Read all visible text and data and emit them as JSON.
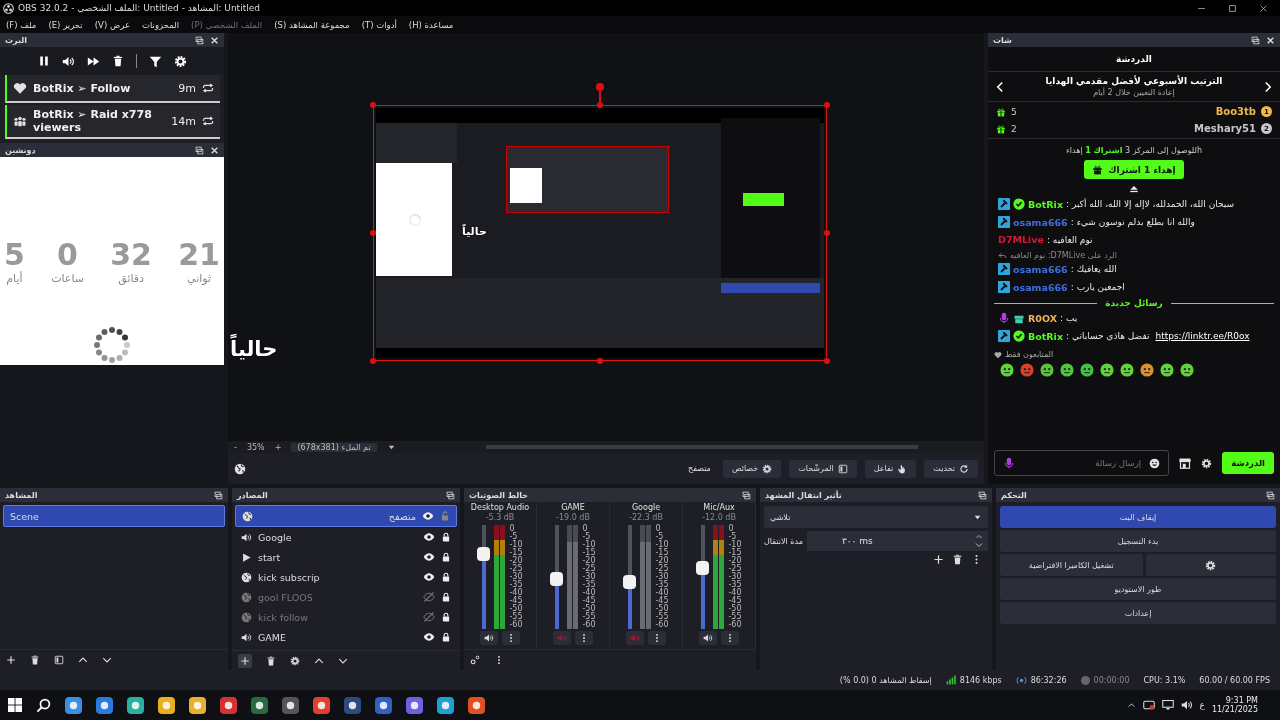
{
  "window": {
    "title": "OBS 32.0.2 - الملف الشخصي: Untitled - المشاهد: Untitled"
  },
  "menu": [
    {
      "label": "مساعدة (H)",
      "disabled": false
    },
    {
      "label": "أدوات (T)",
      "disabled": false
    },
    {
      "label": "مجموعة المشاهد (S)",
      "disabled": false
    },
    {
      "label": "الملف الشخصي (P)",
      "disabled": true
    },
    {
      "label": "المحزونات",
      "disabled": false
    },
    {
      "label": "عرض (V)",
      "disabled": false
    },
    {
      "label": "تحرير (E)",
      "disabled": false
    },
    {
      "label": "ملف (F)",
      "disabled": false
    }
  ],
  "events_dock": {
    "title": "البرت",
    "events": [
      {
        "kind": "follow",
        "text": "BotRix ➢ Follow",
        "time": "9m"
      },
      {
        "kind": "raid",
        "text": "BotRix ➢ Raid x778 viewers",
        "time": "14m"
      }
    ]
  },
  "countdown_dock": {
    "title": "دونشين",
    "counters": [
      {
        "value": "21",
        "unit": "ثواني"
      },
      {
        "value": "32",
        "unit": "دقائق"
      },
      {
        "value": "0",
        "unit": "ساعات"
      },
      {
        "value": "5",
        "unit": "أيام"
      }
    ]
  },
  "preview": {
    "overlay_texts": [
      "حالياً",
      "حالياً"
    ],
    "zoom_out": "-",
    "zoom": "35%",
    "zoom_in": "+",
    "fit": "تم الملء (678x381)"
  },
  "source_toolbar": {
    "source": "متصفح",
    "buttons": [
      {
        "kind": "refresh",
        "label": "تحديث"
      },
      {
        "kind": "interact",
        "label": "تفاعل"
      },
      {
        "kind": "filters",
        "label": "المرشّحات"
      },
      {
        "kind": "properties",
        "label": "خصائص"
      }
    ]
  },
  "chat_dock": {
    "title": "شات",
    "tab": "الدردشة",
    "leaderboard": {
      "title": "الترتيب الأسبوعي لأفضل مقدمي الهدايا",
      "subtitle": "إعادة التعيين خلال 2 أيام",
      "entries": [
        {
          "rank": "1",
          "name": "Boo3tb",
          "count": "5",
          "color": "#f2b84b"
        },
        {
          "rank": "2",
          "name": "Meshary51",
          "count": "2",
          "color": "#c8c8c8"
        }
      ]
    },
    "gift_hint": "hللوصول إلى المركز 3 **اشتراك 1** إهداء",
    "gift_button": "إهداء 1 اشتراك",
    "messages": [
      {
        "user": "BotRix",
        "color": "#53fc18",
        "moderator": true,
        "verified": true,
        "mic_badge": false,
        "gift_badge": false,
        "text": ": سبحان الله، الحمدلله، لاإله إلا الله، الله أكبر"
      },
      {
        "user": "osama666",
        "color": "#3d6fe0",
        "moderator": true,
        "verified": false,
        "mic_badge": false,
        "gift_badge": false,
        "text": ": والله انا بطلع بدلم نوسون شيء"
      },
      {
        "user": "D7MLive",
        "color": "#d4173a",
        "moderator": false,
        "verified": false,
        "mic_badge": false,
        "gift_badge": false,
        "text": ": نوم العافيه"
      },
      {
        "reply": "الرد على D7MLive: نوم العافيه",
        "user": "osama666",
        "color": "#3d6fe0",
        "moderator": true,
        "verified": false,
        "mic_badge": false,
        "gift_badge": false,
        "text": ": الله يعافيك"
      },
      {
        "user": "osama666",
        "color": "#3d6fe0",
        "moderator": true,
        "verified": false,
        "mic_badge": false,
        "gift_badge": false,
        "text": ": اجمعين يارب"
      }
    ],
    "new_messages": {
      "label": "رسائل جديدة",
      "messages": [
        {
          "user": "R0OX",
          "color": "#f0b45a",
          "moderator": false,
          "verified": false,
          "mic_badge": true,
          "gift_badge": true,
          "text": ": يب"
        },
        {
          "user": "BotRix",
          "color": "#53fc18",
          "moderator": true,
          "verified": true,
          "mic_badge": false,
          "gift_badge": false,
          "text": ": تفضل هاذي حساباتي",
          "link": "https://linktr.ee/R0ox"
        }
      ]
    },
    "followers_only": "المتابعون فقط",
    "input_placeholder": "إرسال رسالة",
    "send": "الدردشة"
  },
  "scenes": {
    "title": "المشاهد",
    "items": [
      {
        "label": "Scene",
        "selected": true
      }
    ]
  },
  "sources": {
    "title": "المصادر",
    "items": [
      {
        "kind": "browser",
        "label": "متصفح",
        "selected": true,
        "visible": true,
        "locked": false
      },
      {
        "kind": "audio",
        "label": "Google",
        "selected": false,
        "visible": true,
        "locked": true
      },
      {
        "kind": "media",
        "label": "start",
        "selected": false,
        "visible": true,
        "locked": true
      },
      {
        "kind": "browser",
        "label": "kick subscrip",
        "selected": false,
        "visible": true,
        "locked": true
      },
      {
        "kind": "browser",
        "label": "gool FLOOS",
        "selected": false,
        "visible": false,
        "locked": true
      },
      {
        "kind": "browser",
        "label": "kick follow",
        "selected": false,
        "visible": false,
        "locked": true
      },
      {
        "kind": "audio",
        "label": "GAME",
        "selected": false,
        "visible": true,
        "locked": true
      }
    ]
  },
  "mixer": {
    "title": "خالط الصوتيات",
    "channels": [
      {
        "name": "Mic/Aux",
        "reading": "-12.0 dB",
        "level": 0.59,
        "muted": false,
        "scale": [
          "0",
          "-5",
          "-10",
          "-15",
          "-20",
          "-25",
          "-30",
          "-35",
          "-40",
          "-45",
          "-50",
          "-55",
          "-60"
        ]
      },
      {
        "name": "Google",
        "reading": "-22.3 dB",
        "level": 0.45,
        "muted": true,
        "scale": [
          "0",
          "-5",
          "-10",
          "-15",
          "-20",
          "-25",
          "-30",
          "-35",
          "-40",
          "-45",
          "-50",
          "-55",
          "-60"
        ]
      },
      {
        "name": "GAME",
        "reading": "-19.0 dB",
        "level": 0.48,
        "muted": true,
        "scale": [
          "0",
          "-5",
          "-10",
          "-15",
          "-20",
          "-25",
          "-30",
          "-35",
          "-40",
          "-45",
          "-50",
          "-55",
          "-60"
        ]
      },
      {
        "name": "Desktop Audio",
        "reading": "-5.3 dB",
        "level": 0.72,
        "muted": false,
        "scale": [
          "0",
          "-5",
          "-10",
          "-15",
          "-20",
          "-25",
          "-30",
          "-35",
          "-40",
          "-45",
          "-50",
          "-55",
          "-60"
        ]
      }
    ]
  },
  "transitions": {
    "title": "تأثير انتقال المشهد",
    "transition": "تلاشي",
    "duration_label": "مدة الانتقال",
    "duration": "٣٠٠ ms"
  },
  "controls": {
    "title": "التحكم",
    "buttons": [
      {
        "label": "إيقاف البث",
        "active": true
      },
      {
        "label": "بدء التسجيل",
        "active": false
      },
      {
        "label": "تشغيل الكاميرا الافتراضية",
        "active": false
      },
      {
        "label": "طور الاستوديو",
        "active": false
      },
      {
        "label": "إعدادات",
        "active": false
      }
    ]
  },
  "status_bar": {
    "dropped": "إسقاط المشاهد 0 (0.0 %)",
    "bitrate": "8146 kbps",
    "stream_time": "86:32:26",
    "record_time": "00:00:00",
    "cpu": "CPU: 3.1%",
    "fps": "60.00 / 60.00 FPS"
  },
  "taskbar": {
    "language": "ع",
    "time": "9:31 PM",
    "date": "11/21/2025"
  }
}
